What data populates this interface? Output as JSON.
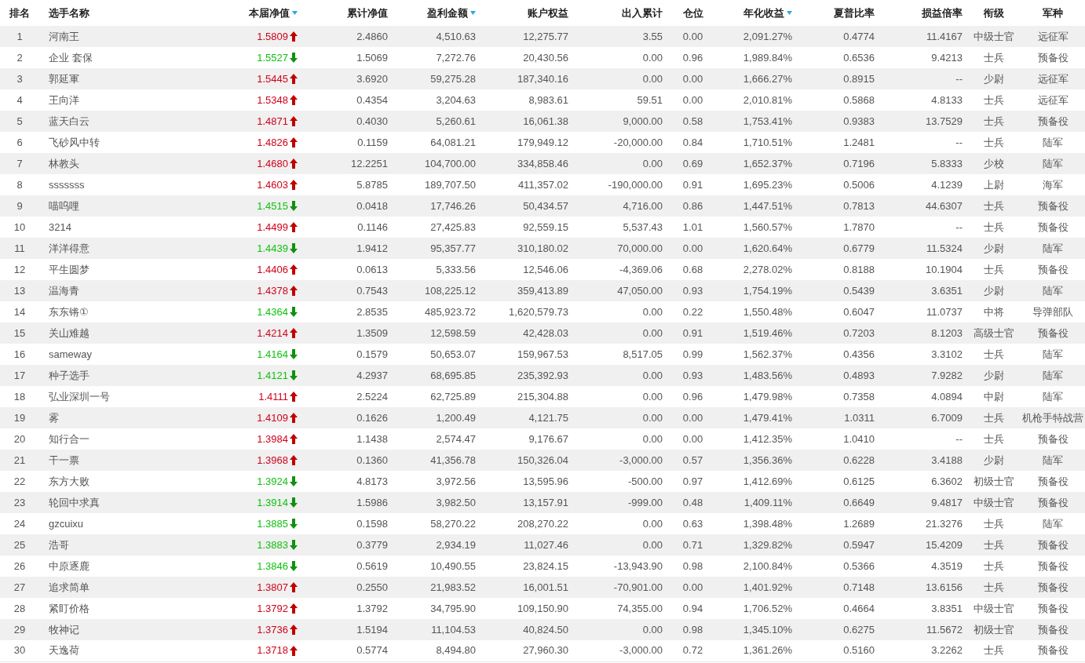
{
  "table": {
    "columns": [
      {
        "label": "排名",
        "kind": "rank",
        "sort_indicator": false
      },
      {
        "label": "选手名称",
        "kind": "name",
        "sort_indicator": false
      },
      {
        "label": "本届净值",
        "kind": "nav",
        "sort_indicator": true
      },
      {
        "label": "累计净值",
        "kind": "number",
        "sort_indicator": false
      },
      {
        "label": "盈利金额",
        "kind": "number",
        "sort_indicator": true
      },
      {
        "label": "账户权益",
        "kind": "number",
        "sort_indicator": false
      },
      {
        "label": "出入累计",
        "kind": "number",
        "sort_indicator": false
      },
      {
        "label": "仓位",
        "kind": "center",
        "sort_indicator": false
      },
      {
        "label": "年化收益",
        "kind": "number",
        "sort_indicator": true
      },
      {
        "label": "夏普比率",
        "kind": "number",
        "sort_indicator": false
      },
      {
        "label": "损益倍率",
        "kind": "number",
        "sort_indicator": false
      },
      {
        "label": "衔级",
        "kind": "center",
        "sort_indicator": false
      },
      {
        "label": "军种",
        "kind": "center",
        "sort_indicator": false
      }
    ],
    "rows": [
      {
        "rising": true,
        "cells": [
          "1",
          "河南王",
          "1.5809",
          "2.4860",
          "4,510.63",
          "12,275.77",
          "3.55",
          "0.00",
          "2,091.27%",
          "0.4774",
          "11.4167",
          "中级士官",
          "远征军"
        ]
      },
      {
        "rising": false,
        "cells": [
          "2",
          "企业 套保",
          "1.5527",
          "1.5069",
          "7,272.76",
          "20,430.56",
          "0.00",
          "0.96",
          "1,989.84%",
          "0.6536",
          "9.4213",
          "士兵",
          "预备役"
        ]
      },
      {
        "rising": true,
        "cells": [
          "3",
          "郭延軍",
          "1.5445",
          "3.6920",
          "59,275.28",
          "187,340.16",
          "0.00",
          "0.00",
          "1,666.27%",
          "0.8915",
          "--",
          "少尉",
          "远征军"
        ]
      },
      {
        "rising": true,
        "cells": [
          "4",
          "王向洋",
          "1.5348",
          "0.4354",
          "3,204.63",
          "8,983.61",
          "59.51",
          "0.00",
          "2,010.81%",
          "0.5868",
          "4.8133",
          "士兵",
          "远征军"
        ]
      },
      {
        "rising": true,
        "cells": [
          "5",
          "蓝天白云",
          "1.4871",
          "0.4030",
          "5,260.61",
          "16,061.38",
          "9,000.00",
          "0.58",
          "1,753.41%",
          "0.9383",
          "13.7529",
          "士兵",
          "预备役"
        ]
      },
      {
        "rising": true,
        "cells": [
          "6",
          "飞砂风中转",
          "1.4826",
          "0.1159",
          "64,081.21",
          "179,949.12",
          "-20,000.00",
          "0.84",
          "1,710.51%",
          "1.2481",
          "--",
          "士兵",
          "陆军"
        ]
      },
      {
        "rising": true,
        "cells": [
          "7",
          "林教头",
          "1.4680",
          "12.2251",
          "104,700.00",
          "334,858.46",
          "0.00",
          "0.69",
          "1,652.37%",
          "0.7196",
          "5.8333",
          "少校",
          "陆军"
        ]
      },
      {
        "rising": true,
        "cells": [
          "8",
          "sssssss",
          "1.4603",
          "5.8785",
          "189,707.50",
          "411,357.02",
          "-190,000.00",
          "0.91",
          "1,695.23%",
          "0.5006",
          "4.1239",
          "上尉",
          "海军"
        ]
      },
      {
        "rising": false,
        "cells": [
          "9",
          "喵呜哩",
          "1.4515",
          "0.0418",
          "17,746.26",
          "50,434.57",
          "4,716.00",
          "0.86",
          "1,447.51%",
          "0.7813",
          "44.6307",
          "士兵",
          "预备役"
        ]
      },
      {
        "rising": true,
        "cells": [
          "10",
          "3214",
          "1.4499",
          "0.1146",
          "27,425.83",
          "92,559.15",
          "5,537.43",
          "1.01",
          "1,560.57%",
          "1.7870",
          "--",
          "士兵",
          "预备役"
        ]
      },
      {
        "rising": false,
        "cells": [
          "11",
          "洋洋得意",
          "1.4439",
          "1.9412",
          "95,357.77",
          "310,180.02",
          "70,000.00",
          "0.00",
          "1,620.64%",
          "0.6779",
          "11.5324",
          "少尉",
          "陆军"
        ]
      },
      {
        "rising": true,
        "cells": [
          "12",
          "平生圆梦",
          "1.4406",
          "0.0613",
          "5,333.56",
          "12,546.06",
          "-4,369.06",
          "0.68",
          "2,278.02%",
          "0.8188",
          "10.1904",
          "士兵",
          "预备役"
        ]
      },
      {
        "rising": true,
        "cells": [
          "13",
          "温海青",
          "1.4378",
          "0.7543",
          "108,225.12",
          "359,413.89",
          "47,050.00",
          "0.93",
          "1,754.19%",
          "0.5439",
          "3.6351",
          "少尉",
          "陆军"
        ]
      },
      {
        "rising": false,
        "cells": [
          "14",
          "东东锵①",
          "1.4364",
          "2.8535",
          "485,923.72",
          "1,620,579.73",
          "0.00",
          "0.22",
          "1,550.48%",
          "0.6047",
          "11.0737",
          "中将",
          "导弹部队"
        ]
      },
      {
        "rising": true,
        "cells": [
          "15",
          "关山难越",
          "1.4214",
          "1.3509",
          "12,598.59",
          "42,428.03",
          "0.00",
          "0.91",
          "1,519.46%",
          "0.7203",
          "8.1203",
          "高级士官",
          "预备役"
        ]
      },
      {
        "rising": false,
        "cells": [
          "16",
          "sameway",
          "1.4164",
          "0.1579",
          "50,653.07",
          "159,967.53",
          "8,517.05",
          "0.99",
          "1,562.37%",
          "0.4356",
          "3.3102",
          "士兵",
          "陆军"
        ]
      },
      {
        "rising": false,
        "cells": [
          "17",
          "种子选手",
          "1.4121",
          "4.2937",
          "68,695.85",
          "235,392.93",
          "0.00",
          "0.93",
          "1,483.56%",
          "0.4893",
          "7.9282",
          "少尉",
          "陆军"
        ]
      },
      {
        "rising": true,
        "cells": [
          "18",
          "弘业深圳一号",
          "1.4111",
          "2.5224",
          "62,725.89",
          "215,304.88",
          "0.00",
          "0.96",
          "1,479.98%",
          "0.7358",
          "4.0894",
          "中尉",
          "陆军"
        ]
      },
      {
        "rising": true,
        "cells": [
          "19",
          "雾",
          "1.4109",
          "0.1626",
          "1,200.49",
          "4,121.75",
          "0.00",
          "0.00",
          "1,479.41%",
          "1.0311",
          "6.7009",
          "士兵",
          "机枪手特战营"
        ]
      },
      {
        "rising": true,
        "cells": [
          "20",
          "知行合一",
          "1.3984",
          "1.1438",
          "2,574.47",
          "9,176.67",
          "0.00",
          "0.00",
          "1,412.35%",
          "1.0410",
          "--",
          "士兵",
          "预备役"
        ]
      },
      {
        "rising": true,
        "cells": [
          "21",
          "干一票",
          "1.3968",
          "0.1360",
          "41,356.78",
          "150,326.04",
          "-3,000.00",
          "0.57",
          "1,356.36%",
          "0.6228",
          "3.4188",
          "少尉",
          "陆军"
        ]
      },
      {
        "rising": false,
        "cells": [
          "22",
          "东方大败",
          "1.3924",
          "4.8173",
          "3,972.56",
          "13,595.96",
          "-500.00",
          "0.97",
          "1,412.69%",
          "0.6125",
          "6.3602",
          "初级士官",
          "预备役"
        ]
      },
      {
        "rising": false,
        "cells": [
          "23",
          "轮回中求真",
          "1.3914",
          "1.5986",
          "3,982.50",
          "13,157.91",
          "-999.00",
          "0.48",
          "1,409.11%",
          "0.6649",
          "9.4817",
          "中级士官",
          "预备役"
        ]
      },
      {
        "rising": false,
        "cells": [
          "24",
          "gzcuixu",
          "1.3885",
          "0.1598",
          "58,270.22",
          "208,270.22",
          "0.00",
          "0.63",
          "1,398.48%",
          "1.2689",
          "21.3276",
          "士兵",
          "陆军"
        ]
      },
      {
        "rising": false,
        "cells": [
          "25",
          "浩哥",
          "1.3883",
          "0.3779",
          "2,934.19",
          "11,027.46",
          "0.00",
          "0.71",
          "1,329.82%",
          "0.5947",
          "15.4209",
          "士兵",
          "预备役"
        ]
      },
      {
        "rising": false,
        "cells": [
          "26",
          "中原逐鹿",
          "1.3846",
          "0.5619",
          "10,490.55",
          "23,824.15",
          "-13,943.90",
          "0.98",
          "2,100.84%",
          "0.5366",
          "4.3519",
          "士兵",
          "预备役"
        ]
      },
      {
        "rising": true,
        "cells": [
          "27",
          "追求简单",
          "1.3807",
          "0.2550",
          "21,983.52",
          "16,001.51",
          "-70,901.00",
          "0.00",
          "1,401.92%",
          "0.7148",
          "13.6156",
          "士兵",
          "预备役"
        ]
      },
      {
        "rising": true,
        "cells": [
          "28",
          "紧盯价格",
          "1.3792",
          "1.3792",
          "34,795.90",
          "109,150.90",
          "74,355.00",
          "0.94",
          "1,706.52%",
          "0.4664",
          "3.8351",
          "中级士官",
          "预备役"
        ]
      },
      {
        "rising": true,
        "cells": [
          "29",
          "牧神记",
          "1.3736",
          "1.5194",
          "11,104.53",
          "40,824.50",
          "0.00",
          "0.98",
          "1,345.10%",
          "0.6275",
          "11.5672",
          "初级士官",
          "预备役"
        ]
      },
      {
        "rising": true,
        "cells": [
          "30",
          "天逸荷",
          "1.3718",
          "0.5774",
          "8,494.80",
          "27,960.30",
          "-3,000.00",
          "0.72",
          "1,361.26%",
          "0.5160",
          "3.2262",
          "士兵",
          "预备役"
        ]
      }
    ]
  }
}
